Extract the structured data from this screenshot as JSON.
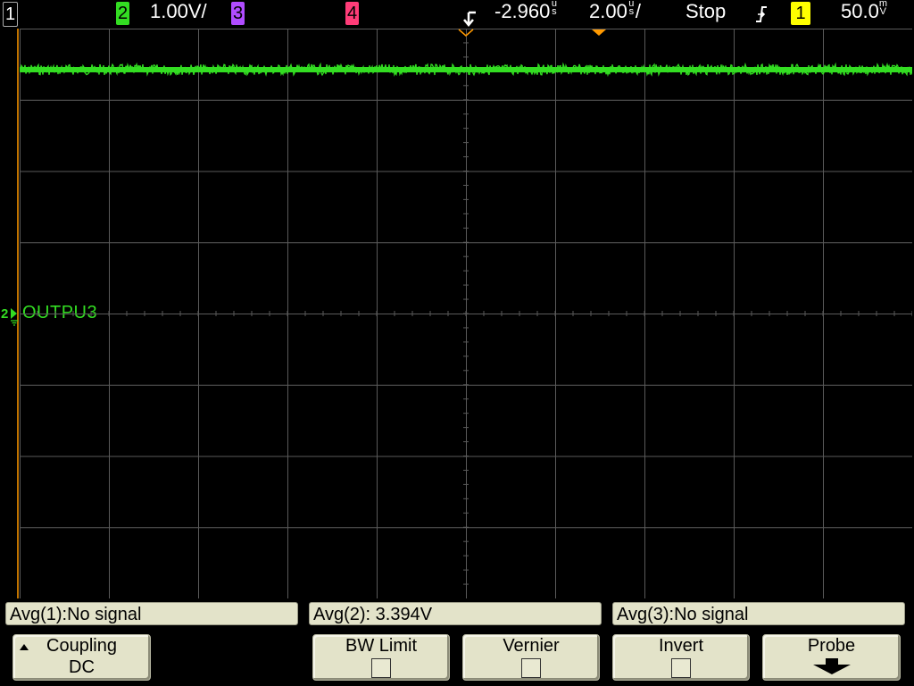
{
  "topbar": {
    "ch1_label": "1",
    "ch2_label": "2",
    "ch2_scale": "1.00V/",
    "ch3_label": "3",
    "ch4_label": "4",
    "delay_value": "-2.960",
    "delay_unit_top": "u",
    "delay_unit_bottom": "s",
    "timebase_value": "2.00",
    "timebase_unit_top": "u",
    "timebase_unit_bottom": "s",
    "timebase_slash": "/",
    "run_state": "Stop",
    "trigger_source": "1",
    "trigger_level_value": "50.0",
    "trigger_level_unit_top": "m",
    "trigger_level_unit_bottom": "V"
  },
  "colors": {
    "ch1": "#ffff00",
    "ch2": "#33dd22",
    "ch3": "#b04cff",
    "ch4": "#ff3c78",
    "trigger_marker": "#ff9900",
    "graticule": "#5a5a5a",
    "softkey_bg": "#e3e3c9"
  },
  "screen": {
    "channel_marker": "2",
    "channel_name": "OUTPU3"
  },
  "readouts": [
    {
      "text": "Avg(1):No signal"
    },
    {
      "text": "Avg(2): 3.394V"
    },
    {
      "text": "Avg(3):No signal"
    }
  ],
  "softkeys": {
    "coupling_label": "Coupling",
    "coupling_value": "DC",
    "bw_limit_label": "BW Limit",
    "vernier_label": "Vernier",
    "invert_label": "Invert",
    "probe_label": "Probe"
  }
}
